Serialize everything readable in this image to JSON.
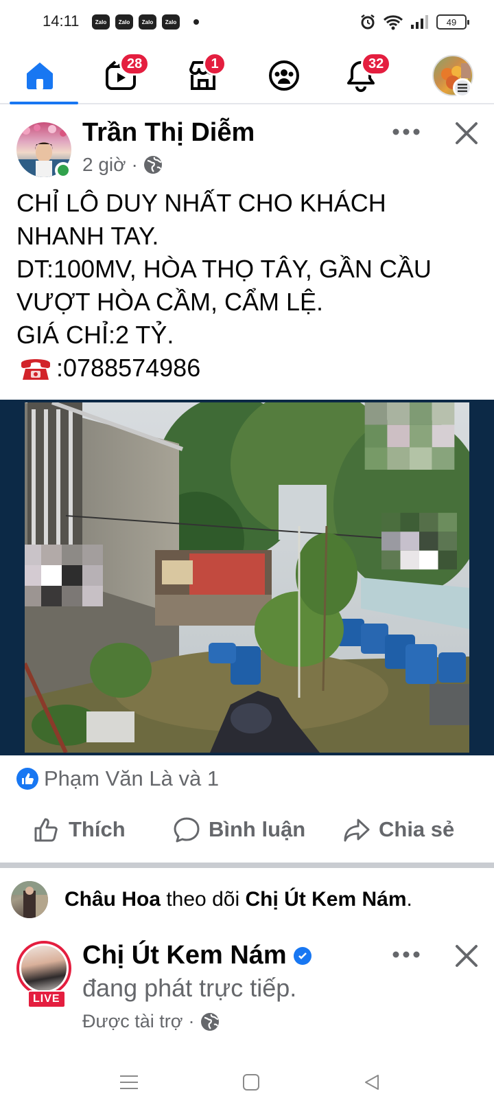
{
  "status_bar": {
    "time": "14:11",
    "zalo_label": "Zalo",
    "battery": "49"
  },
  "nav": {
    "items": [
      {
        "name": "home",
        "icon": "home-icon",
        "badge": ""
      },
      {
        "name": "watch",
        "icon": "video-icon",
        "badge": "28"
      },
      {
        "name": "marketplace",
        "icon": "store-icon",
        "badge": "1"
      },
      {
        "name": "groups",
        "icon": "groups-icon",
        "badge": ""
      },
      {
        "name": "notifications",
        "icon": "bell-icon",
        "badge": "32"
      },
      {
        "name": "menu",
        "icon": "profile-menu-icon",
        "badge": ""
      }
    ]
  },
  "post": {
    "author": "Trần Thị Diễm",
    "time": "2 giờ",
    "separator": "·",
    "privacy_icon": "globe-icon",
    "text_lines": [
      "CHỈ LÔ DUY NHẤT CHO KHÁCH",
      "NHANH TAY.",
      "DT:100MV, HÒA THỌ TÂY, GẦN CẦU",
      "VƯỢT HÒA CẦM, CẨM LỆ.",
      "GIÁ CHỈ:2 TỶ."
    ],
    "phone": ":0788574986",
    "reactions_text": "Phạm Văn Là và 1",
    "actions": {
      "like": "Thích",
      "comment": "Bình luận",
      "share": "Chia sẻ"
    }
  },
  "follow_notice": {
    "actor": "Châu Hoa",
    "verb": " theo dõi ",
    "target": "Chị Út Kem Nám",
    "end": "."
  },
  "sponsored_post": {
    "name": "Chị Út Kem Nám",
    "status": "đang phát trực tiếp.",
    "sponsored": "Được tài trợ",
    "separator": "·",
    "live_label": "LIVE"
  },
  "colors": {
    "brand_blue": "#1877f2",
    "badge_red": "#e41e3f",
    "secondary_text": "#65676b"
  }
}
